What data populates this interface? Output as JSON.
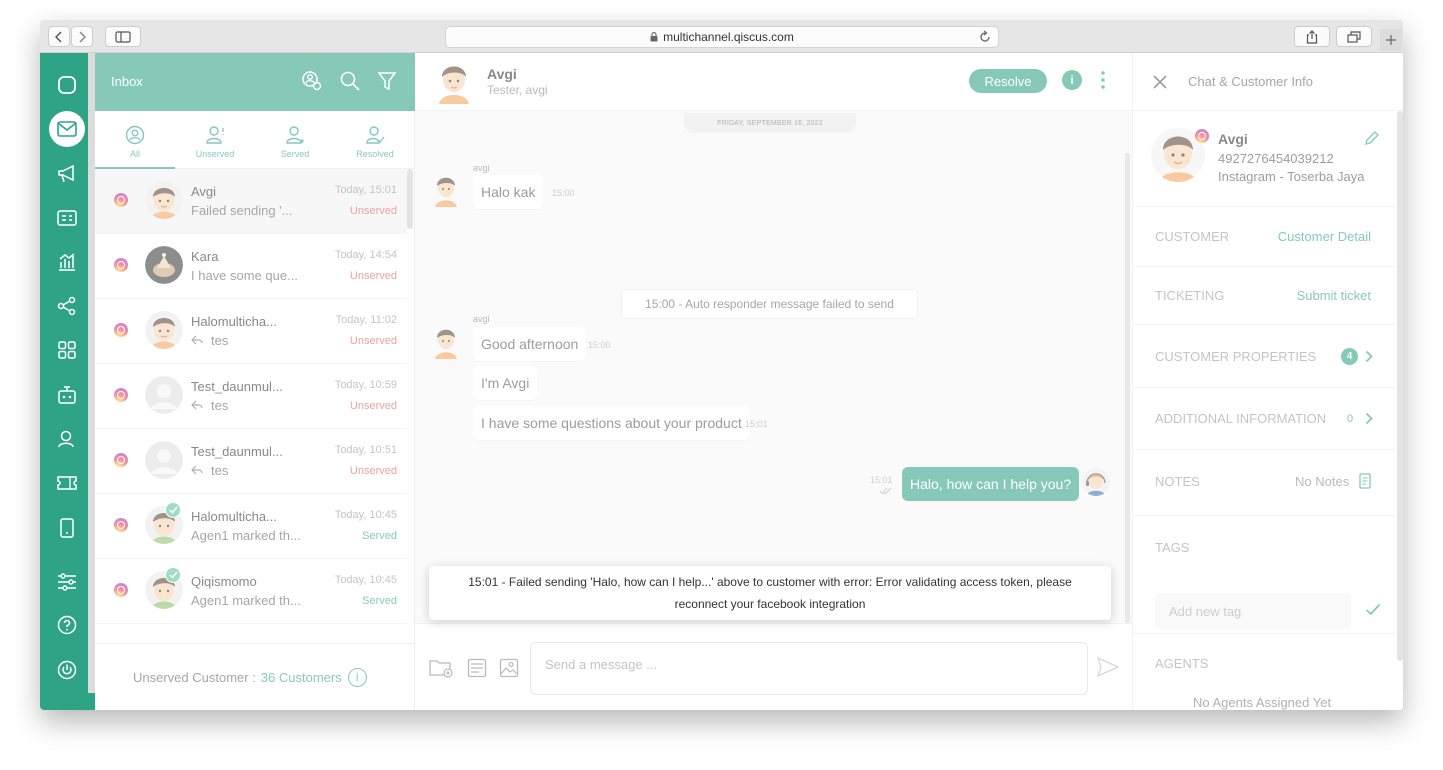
{
  "browser": {
    "url": "multichannel.qiscus.com"
  },
  "inbox": {
    "title": "Inbox",
    "filters": [
      {
        "label": "All"
      },
      {
        "label": "Unserved"
      },
      {
        "label": "Served"
      },
      {
        "label": "Resolved"
      }
    ],
    "conversations": [
      {
        "name": "Avgi",
        "preview": "Failed sending '...",
        "time": "Today, 15:01",
        "status": "Unserved"
      },
      {
        "name": "Kara",
        "preview": "I have some que...",
        "time": "Today, 14:54",
        "status": "Unserved"
      },
      {
        "name": "Halomulticha...",
        "preview": "tes",
        "time": "Today, 11:02",
        "status": "Unserved"
      },
      {
        "name": "Test_daunmul...",
        "preview": "tes",
        "time": "Today, 10:59",
        "status": "Unserved"
      },
      {
        "name": "Test_daunmul...",
        "preview": "tes",
        "time": "Today, 10:51",
        "status": "Unserved"
      },
      {
        "name": "Halomulticha...",
        "preview": "Agen1 marked th...",
        "time": "Today, 10:45",
        "status": "Served"
      },
      {
        "name": "Qiqismomo",
        "preview": "Agen1 marked th...",
        "time": "Today, 10:45",
        "status": "Served"
      }
    ],
    "footer": {
      "label": "Unserved Customer :",
      "count": "36 Customers",
      "info": "i"
    }
  },
  "chat": {
    "name": "Avgi",
    "subtitle": "Tester, avgi",
    "resolve_label": "Resolve",
    "info_label": "i",
    "date": "FRIDAY, SEPTEMBER 16, 2022",
    "sender1": "avgi",
    "msg1": "Halo kak",
    "msg1_time": "15:00",
    "system_msg": "15:00 - Auto responder message failed to send",
    "sender2": "avgi",
    "msg2": "Good afternoon",
    "msg2_time": "15:00",
    "msg3": "I'm Avgi",
    "msg4": "I have some questions about your product",
    "msg4_time": "15:01",
    "out_msg": "Halo, how can I help you?",
    "out_time": "15:01",
    "input_placeholder": "Send a message ..."
  },
  "toast": {
    "text": "15:01 - Failed sending 'Halo, how can I help...' above to customer with error: Error validating access token, please reconnect your facebook integration"
  },
  "panel": {
    "title": "Chat & Customer Info",
    "name": "Avgi",
    "id": "4927276454039212",
    "channel": "Instagram - Toserba Jaya",
    "customer_label": "CUSTOMER",
    "customer_link": "Customer Detail",
    "ticketing_label": "TICKETING",
    "ticketing_link": "Submit ticket",
    "properties_label": "CUSTOMER PROPERTIES",
    "properties_count": "4",
    "additional_label": "ADDITIONAL INFORMATION",
    "additional_count": "0",
    "notes_label": "NOTES",
    "notes_value": "No Notes",
    "tags_label": "TAGS",
    "tag_placeholder": "Add new tag",
    "agents_label": "AGENTS",
    "agents_value": "No Agents Assigned Yet"
  },
  "colors": {
    "brand": "#2fa386",
    "unserved": "#e05a5a"
  }
}
